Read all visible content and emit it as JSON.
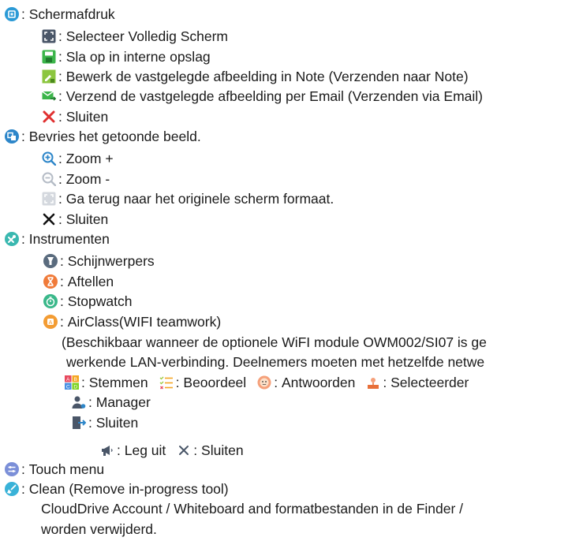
{
  "colon": ":",
  "screenshot": {
    "label": "Schermafdruk",
    "items": [
      {
        "icon": "fullscreen-select-icon",
        "label": "Selecteer Volledig Scherm"
      },
      {
        "icon": "save-icon",
        "label": "Sla op in interne opslag"
      },
      {
        "icon": "edit-note-icon",
        "label": "Bewerk de vastgelegde afbeelding in Note (Verzenden naar Note)"
      },
      {
        "icon": "send-email-icon",
        "label": "Verzend de vastgelegde afbeelding per Email (Verzenden via Email)"
      },
      {
        "icon": "close-red-icon",
        "label": "Sluiten"
      }
    ]
  },
  "freeze": {
    "label": "Bevries het getoonde beeld.",
    "items": [
      {
        "icon": "zoom-in-icon",
        "label": "Zoom +"
      },
      {
        "icon": "zoom-out-icon",
        "label": "Zoom -"
      },
      {
        "icon": "original-size-icon",
        "label": "Ga terug naar het originele scherm formaat."
      },
      {
        "icon": "close-icon",
        "label": "Sluiten"
      }
    ]
  },
  "tools": {
    "label": "Instrumenten",
    "items": [
      {
        "icon": "spotlight-icon",
        "label": "Schijnwerpers"
      },
      {
        "icon": "countdown-icon",
        "label": "Aftellen"
      },
      {
        "icon": "stopwatch-icon",
        "label": "Stopwatch"
      },
      {
        "icon": "airclass-icon",
        "label": "AirClass(WIFI teamwork)"
      }
    ],
    "airclass_note_1": "(Beschikbaar wanneer de optionele WiFI module OWM002/SI07 is ge",
    "airclass_note_2": "werkende LAN-verbinding. Deelnemers moeten met hetzelfde netwe",
    "airclass_functions": {
      "vote": "Stemmen",
      "rate": "Beoordeel",
      "answer": "Antwoorden",
      "selector": "Selecteerder"
    },
    "manager": "Manager",
    "exit": "Sluiten",
    "sub": {
      "explain": "Leg uit",
      "close": "Sluiten"
    }
  },
  "touch_menu": {
    "label": "Touch menu"
  },
  "clean": {
    "label": "Clean (Remove in-progress tool)",
    "note_1": "CloudDrive Account / Whiteboard and formatbestanden in de Finder /",
    "note_2": "worden verwijderd."
  },
  "colors": {
    "screenshot_blue": "#2b9ad6",
    "save_green": "#3bb54a",
    "close_red": "#e03030",
    "zoom_blue": "#2d86c9",
    "tools_teal": "#3ab8b0",
    "countdown_orange": "#f07b3a",
    "airclass_orange": "#f39c33",
    "touch_purple": "#7b8fd8",
    "clean_cyan": "#39b2d8"
  }
}
